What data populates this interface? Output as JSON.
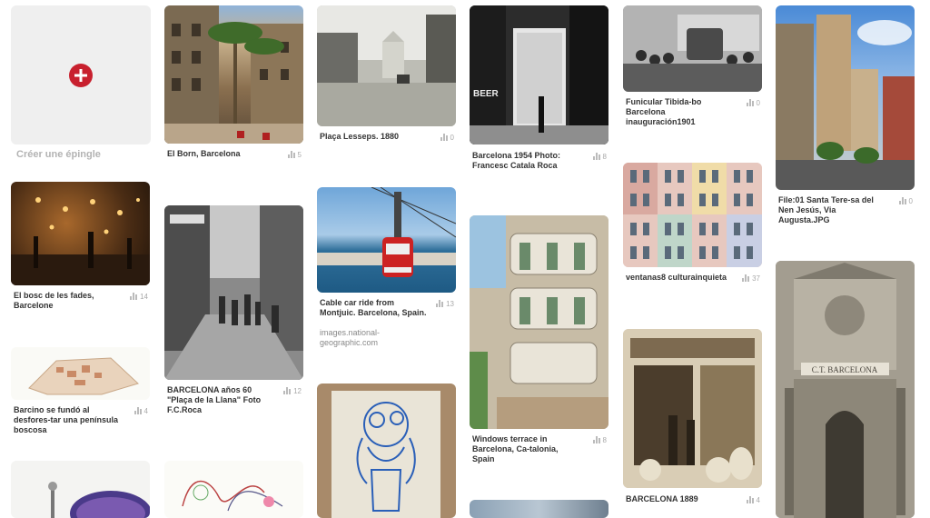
{
  "create_pin": {
    "label": "Créer une épingle"
  },
  "pins": [
    {
      "id": "el-born",
      "title": "El Born, Barcelona",
      "source": "",
      "count": "5"
    },
    {
      "id": "placa-lesseps",
      "title": "Plaça Lesseps. 1880",
      "source": "",
      "count": "0"
    },
    {
      "id": "barcelona-1954",
      "title": "Barcelona 1954 Photo: Francesc Catala Roca",
      "source": "",
      "count": "8"
    },
    {
      "id": "funicular",
      "title": "Funicular Tibida-bo Barcelona inauguración1901",
      "source": "",
      "count": "0"
    },
    {
      "id": "santa-teresa",
      "title": "File:01 Santa Tere-sa del Nen Jesús, Via Augusta.JPG",
      "source": "",
      "count": "0"
    },
    {
      "id": "bosc-fades",
      "title": "El bosc de les fades, Barcelone",
      "source": "",
      "count": "14"
    },
    {
      "id": "barcelona-60",
      "title": "BARCELONA años 60 \"Plaça de la Llana\" Foto F.C.Roca",
      "source": "",
      "count": "12"
    },
    {
      "id": "cable-car",
      "title": "Cable car ride from Montjuic. Barcelona, Spain.",
      "source": "images.national-geographic.com",
      "count": "13"
    },
    {
      "id": "windows-terrace",
      "title": "Windows terrace in Barcelona, Ca-talonia, Spain",
      "source": "",
      "count": "8"
    },
    {
      "id": "ventanas",
      "title": "ventanas8 culturainquieta",
      "source": "",
      "count": "37"
    },
    {
      "id": "barcino",
      "title": "Barcino se fundó al desfores-tar una península boscosa",
      "source": "",
      "count": "4"
    },
    {
      "id": "barcelona-1889",
      "title": "BARCELONA 1889",
      "source": "",
      "count": "4"
    }
  ],
  "sign_text": "C.T. BARCELONA",
  "beer_sign": "BEER"
}
